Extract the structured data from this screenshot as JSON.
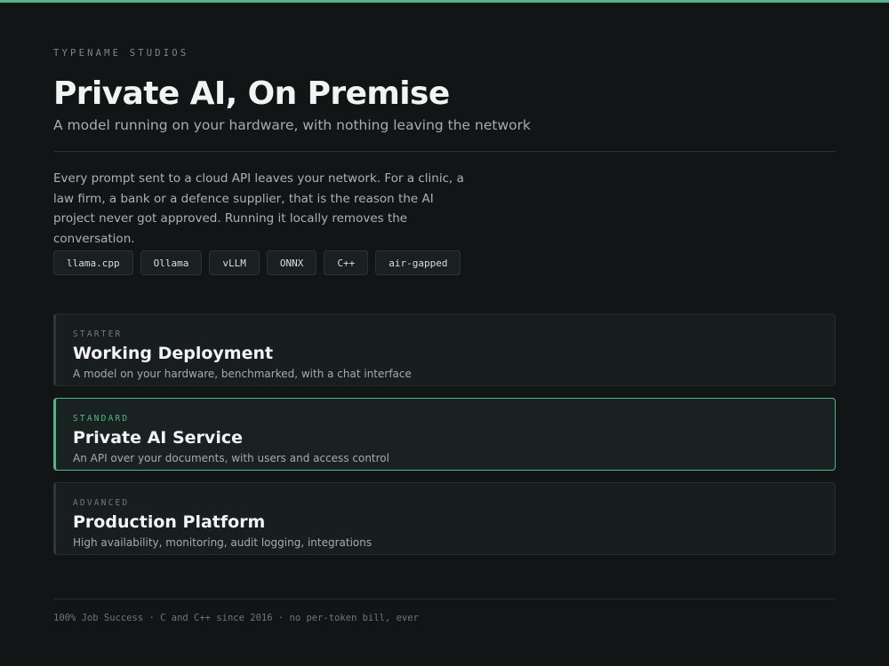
{
  "header": {
    "eyebrow": "TYPENAME STUDIOS",
    "title": "Private AI, On Premise",
    "subtitle": "A model running on your hardware, with nothing leaving the network"
  },
  "intro": "Every prompt sent to a cloud API leaves your network. For a clinic, a law firm, a bank or a defence supplier, that is the reason the AI project never got approved. Running it locally removes the conversation.",
  "tags": [
    "llama.cpp",
    "Ollama",
    "vLLM",
    "ONNX",
    "C++",
    "air-gapped"
  ],
  "tiers": [
    {
      "label": "STARTER",
      "title": "Working Deployment",
      "description": "A model on your hardware, benchmarked, with a chat interface",
      "selected": false
    },
    {
      "label": "STANDARD",
      "title": "Private AI Service",
      "description": "An API over your documents, with users and access control",
      "selected": true
    },
    {
      "label": "ADVANCED",
      "title": "Production Platform",
      "description": "High availability, monitoring, audit logging, integrations",
      "selected": false
    }
  ],
  "footer": "100% Job Success · C and C++ since 2016 · no per-token bill, ever",
  "colors": {
    "accent": "#4fb586",
    "background": "#111515"
  }
}
